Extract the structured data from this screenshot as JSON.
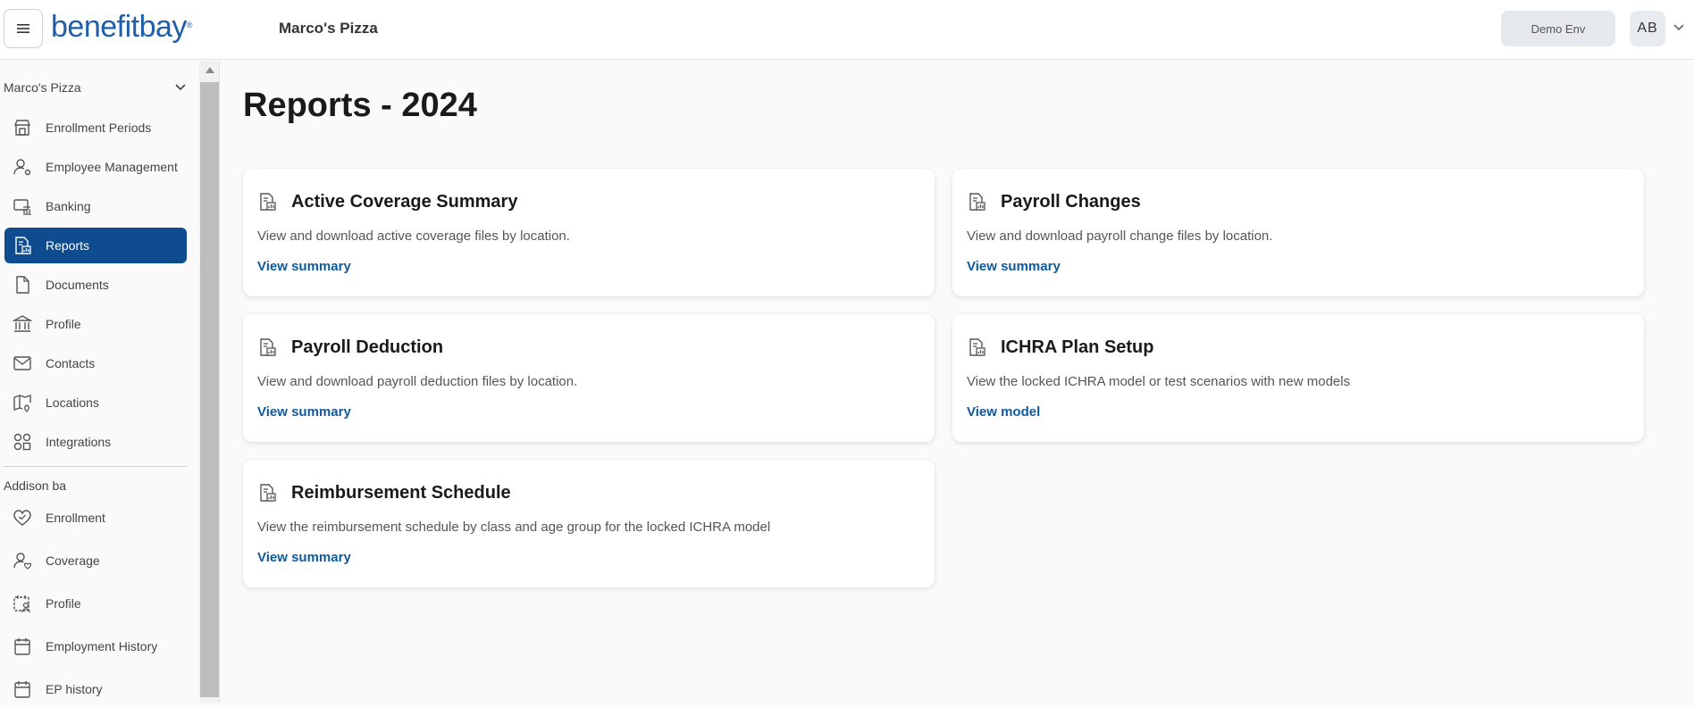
{
  "header": {
    "logo_text": "benefitbay",
    "logo_mark": "®",
    "company_name": "Marco's Pizza",
    "env_label": "Demo Env",
    "avatar_initials": "AB"
  },
  "sidebar": {
    "company_select": "Marco's Pizza",
    "employer_items": [
      {
        "label": "Enrollment Periods",
        "icon": "store-icon"
      },
      {
        "label": "Employee Management",
        "icon": "user-gear-icon"
      },
      {
        "label": "Banking",
        "icon": "bank-card-icon"
      },
      {
        "label": "Reports",
        "icon": "report-icon",
        "active": true
      },
      {
        "label": "Documents",
        "icon": "document-icon"
      },
      {
        "label": "Profile",
        "icon": "building-icon"
      },
      {
        "label": "Contacts",
        "icon": "mail-icon"
      },
      {
        "label": "Locations",
        "icon": "map-pin-icon"
      },
      {
        "label": "Integrations",
        "icon": "integrations-icon"
      }
    ],
    "employee_section_label": "Addison ba",
    "employee_items": [
      {
        "label": "Enrollment",
        "icon": "heart-icon"
      },
      {
        "label": "Coverage",
        "icon": "user-heart-icon"
      },
      {
        "label": "Profile",
        "icon": "calendar-user-icon"
      },
      {
        "label": "Employment History",
        "icon": "calendar-icon"
      },
      {
        "label": "EP history",
        "icon": "calendar-icon"
      }
    ]
  },
  "main": {
    "page_title": "Reports - 2024",
    "cards": [
      {
        "title": "Active Coverage Summary",
        "description": "View and download active coverage files by location.",
        "link": "View summary"
      },
      {
        "title": "Payroll Changes",
        "description": "View and download payroll change files by location.",
        "link": "View summary"
      },
      {
        "title": "Payroll Deduction",
        "description": "View and download payroll deduction files by location.",
        "link": "View summary"
      },
      {
        "title": "ICHRA Plan Setup",
        "description": "View the locked ICHRA model or test scenarios with new models",
        "link": "View model"
      },
      {
        "title": "Reimbursement Schedule",
        "description": "View the reimbursement schedule by class and age group for the locked ICHRA model",
        "link": "View summary"
      }
    ]
  },
  "colors": {
    "brand": "#1f5ea8",
    "active_nav": "#0f4c8f",
    "link": "#0f5aa0"
  }
}
